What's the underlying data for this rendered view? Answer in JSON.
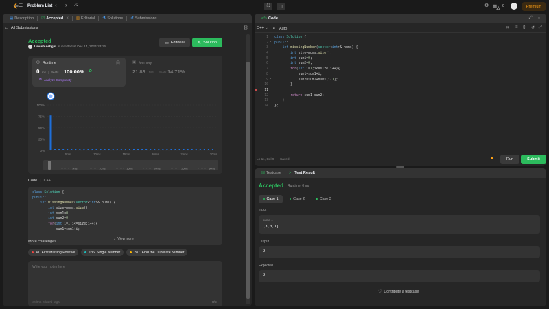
{
  "topbar": {
    "problem_list": "Problem List",
    "streak_count": "0",
    "premium": "Premium"
  },
  "left_tabs": [
    {
      "label": "Description",
      "icon": "document-icon"
    },
    {
      "label": "Accepted",
      "icon": "check-icon",
      "close": "×"
    },
    {
      "label": "Editorial",
      "icon": "book-icon"
    },
    {
      "label": "Solutions",
      "icon": "flask-icon"
    },
    {
      "label": "Submissions",
      "icon": "history-icon"
    }
  ],
  "submission": {
    "back_label": "All Submissions",
    "status": "Accepted",
    "user": "Lavish sehgal",
    "submitted_at": "submitted at Dec 14, 2024 23:16",
    "editorial_btn": "Editorial",
    "solution_btn": "Solution",
    "runtime_label": "Runtime",
    "runtime_value": "0",
    "runtime_unit": "ms",
    "beats_label": "Beats",
    "runtime_beats": "100.00%",
    "analyze": "Analyze Complexity",
    "memory_label": "Memory",
    "memory_value": "21.83",
    "memory_unit": "MB",
    "memory_beats": "14.71%"
  },
  "chart_data": {
    "type": "bar",
    "y_ticks": [
      "100%",
      "75%",
      "50%",
      "25%",
      "0%"
    ],
    "x_ticks": [
      "5ms",
      "10ms",
      "15ms",
      "20ms",
      "25ms",
      "30ms"
    ],
    "mini_ticks": [
      "5ms",
      "10ms",
      "15ms",
      "20ms",
      "25ms",
      "30ms"
    ],
    "ylim": [
      0,
      100
    ],
    "bar_color": "#1e6fd9",
    "highlight_value": 77
  },
  "left_code": {
    "header": "Code",
    "lang": "C++",
    "view_more": "View more"
  },
  "more": {
    "title": "More challenges",
    "items": [
      {
        "label": "41. First Missing Positive",
        "color": "#ef4743"
      },
      {
        "label": "136. Single Number",
        "color": "#1cbaba"
      },
      {
        "label": "287. Find the Duplicate Number",
        "color": "#ffb800"
      }
    ],
    "notes_placeholder": "Write your notes here",
    "tags_placeholder": "Select related tags",
    "notes_count": "0/5"
  },
  "editor": {
    "tab": "Code",
    "lang": "C++",
    "auto": "Auto",
    "status": "Ln 11, Col 9",
    "saved": "Saved",
    "run": "Run",
    "submit": "Submit"
  },
  "testpanel": {
    "tab_testcase": "Testcase",
    "tab_result": "Test Result",
    "status": "Accepted",
    "runtime": "Runtime: 0 ms",
    "cases": [
      "Case 1",
      "Case 2",
      "Case 3"
    ],
    "input_label": "Input",
    "input_var": "nums =",
    "input_value": "[3,0,1]",
    "output_label": "Output",
    "output_value": "2",
    "expected_label": "Expected",
    "expected_value": "2",
    "contribute": "Contribute a testcase"
  }
}
